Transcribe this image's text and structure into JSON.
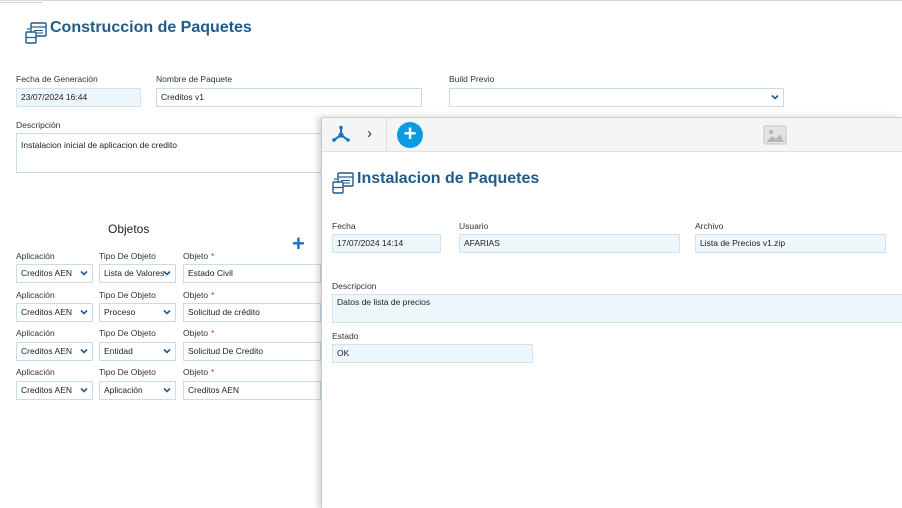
{
  "main": {
    "title": "Construccion de Paquetes",
    "fecha_label": "Fecha de Generación",
    "fecha_value": "23/07/2024 16:44",
    "nombre_label": "Nombre de Paquete",
    "nombre_value": "Creditos v1",
    "build_label": "Build Previo",
    "build_value": "",
    "descripcion_label": "Descripción",
    "descripcion_value": "Instalacion inicial de aplicacion de credito",
    "objetos_title": "Objetos",
    "rows": [
      {
        "app_label": "Aplicación",
        "app_value": "Creditos AEN",
        "tipo_label": "Tipo De Objeto",
        "tipo_value": "Lista de Valores",
        "obj_label": "Objeto",
        "obj_value": "Estado Civil"
      },
      {
        "app_label": "Aplicación",
        "app_value": "Creditos AEN",
        "tipo_label": "Tipo De Objeto",
        "tipo_value": "Proceso",
        "obj_label": "Objeto",
        "obj_value": "Solicitud de crédito"
      },
      {
        "app_label": "Aplicación",
        "app_value": "Creditos AEN",
        "tipo_label": "Tipo De Objeto",
        "tipo_value": "Entidad",
        "obj_label": "Objeto",
        "obj_value": "Solicitud De Credito"
      },
      {
        "app_label": "Aplicación",
        "app_value": "Creditos AEN",
        "tipo_label": "Tipo De Objeto",
        "tipo_value": "Aplicación",
        "obj_label": "Objeto",
        "obj_value": "Creditos AEN"
      }
    ],
    "required_mark": "*"
  },
  "overlay": {
    "title": "Instalacion de Paquetes",
    "fecha_label": "Fecha",
    "fecha_value": "17/07/2024 14:14",
    "usuario_label": "Usuario",
    "usuario_value": "AFARIAS",
    "archivo_label": "Archivo",
    "archivo_value": "Lista de Precios v1.zip",
    "descripcion_label": "Descripcion",
    "descripcion_value": "Datos de lista de precios",
    "estado_label": "Estado",
    "estado_value": "OK",
    "chevron": "›",
    "add": "+"
  },
  "icons": {
    "package": "package-icon",
    "network": "network-icon",
    "image": "image-icon",
    "plus": "plus-icon"
  },
  "colors": {
    "title": "#1f5c8c",
    "accent": "#0b9be0",
    "required": "#e0322a",
    "field_readonly": "#edf6fb"
  }
}
